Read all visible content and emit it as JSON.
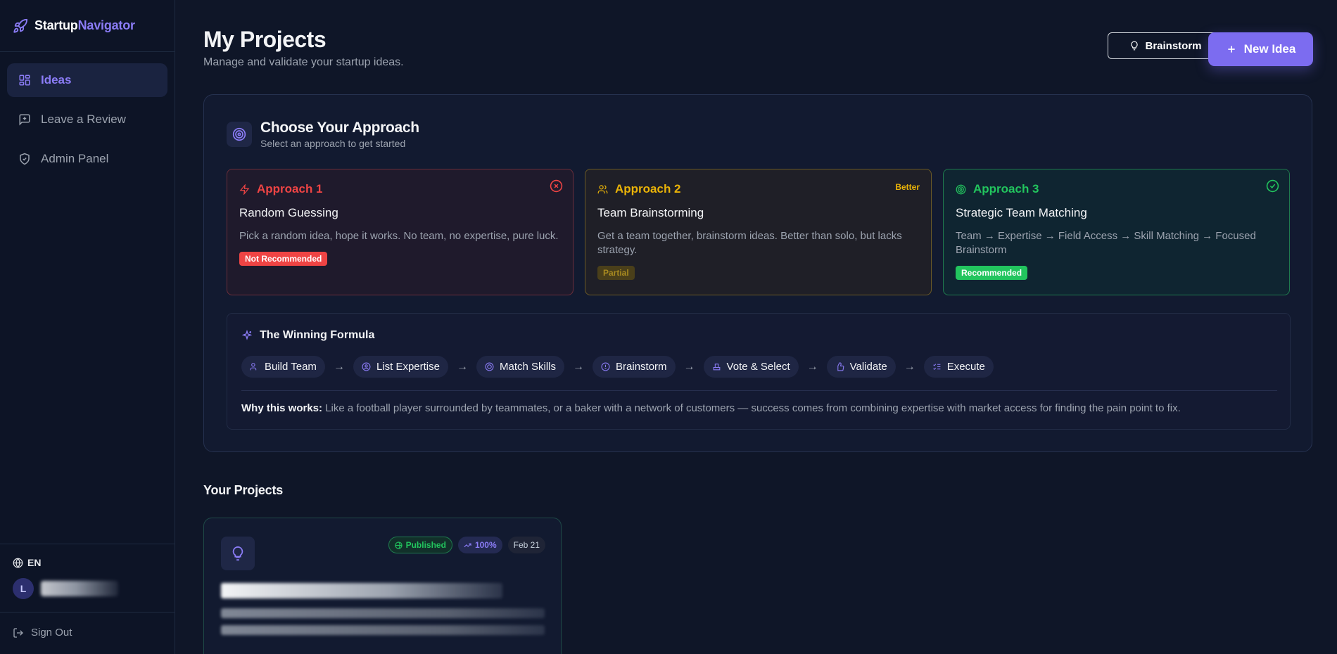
{
  "brand": {
    "name_part1": "Startup",
    "name_part2": "Navigator"
  },
  "sidebar": {
    "items": [
      {
        "label": "Ideas",
        "icon": "grid-icon",
        "active": true
      },
      {
        "label": "Leave a Review",
        "icon": "message-plus-icon"
      },
      {
        "label": "Admin Panel",
        "icon": "shield-icon"
      }
    ],
    "language": "EN",
    "user_initial": "L",
    "sign_out": "Sign Out"
  },
  "header": {
    "title": "My Projects",
    "subtitle": "Manage and validate your startup ideas.",
    "brainstorm_label": "Brainstorm",
    "new_idea_label": "New Idea"
  },
  "approach": {
    "title": "Choose Your Approach",
    "subtitle": "Select an approach to get started",
    "cards": [
      {
        "tag": "Approach 1",
        "name": "Random Guessing",
        "desc": "Pick a random idea, hope it works. No team, no expertise, pure luck.",
        "badge": "Not Recommended",
        "color": "#ef4444"
      },
      {
        "tag": "Approach 2",
        "name": "Team Brainstorming",
        "desc": "Get a team together, brainstorm ideas. Better than solo, but lacks strategy.",
        "badge": "Partial",
        "corner": "Better",
        "color": "#eab308"
      },
      {
        "tag": "Approach 3",
        "name": "Strategic Team Matching",
        "desc": "Team → Expertise → Field Access → Skill Matching → Focused Brainstorm",
        "badge": "Recommended",
        "color": "#22c55e"
      }
    ]
  },
  "formula": {
    "title": "The Winning Formula",
    "steps": [
      "Build Team",
      "List Expertise",
      "Match Skills",
      "Brainstorm",
      "Vote & Select",
      "Validate",
      "Execute"
    ],
    "why_label": "Why this works:",
    "why_text": "Like a football player surrounded by teammates, or a baker with a network of customers — success comes from combining expertise with market access for finding the pain point to fix."
  },
  "projects": {
    "section_title": "Your Projects",
    "items": [
      {
        "status": "Published",
        "progress": "100%",
        "date": "Feb 21"
      }
    ]
  }
}
